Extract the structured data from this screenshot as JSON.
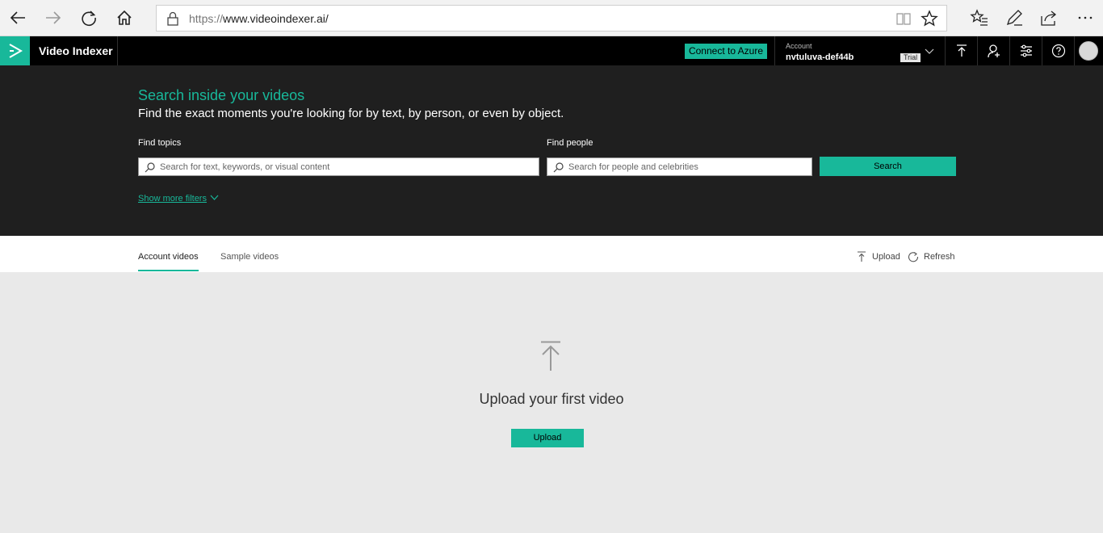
{
  "browser": {
    "url_scheme": "https://",
    "url_host": "www.videoindexer.ai/",
    "back_icon": "back-arrow-icon",
    "forward_icon": "forward-arrow-icon",
    "refresh_icon": "refresh-icon",
    "home_icon": "home-icon"
  },
  "header": {
    "app_title": "Video Indexer",
    "connect_label": "Connect to Azure",
    "account_label": "Account",
    "account_name": "nvtuluva-def44b",
    "trial_badge": "Trial"
  },
  "hero": {
    "title": "Search inside your videos",
    "subtitle": "Find the exact moments you're looking for by text, by person, or even by object.",
    "topics_label": "Find topics",
    "topics_placeholder": "Search for text, keywords, or visual content",
    "people_label": "Find people",
    "people_placeholder": "Search for people and celebrities",
    "search_label": "Search",
    "more_filters": "Show more filters"
  },
  "tabs": {
    "account_videos": "Account videos",
    "sample_videos": "Sample videos",
    "upload": "Upload",
    "refresh": "Refresh"
  },
  "empty_state": {
    "message": "Upload your first video",
    "upload_label": "Upload"
  },
  "colors": {
    "accent": "#18b89a",
    "header_bg": "#000000",
    "hero_bg": "#1f1f1f",
    "content_bg": "#e9e9e9"
  }
}
